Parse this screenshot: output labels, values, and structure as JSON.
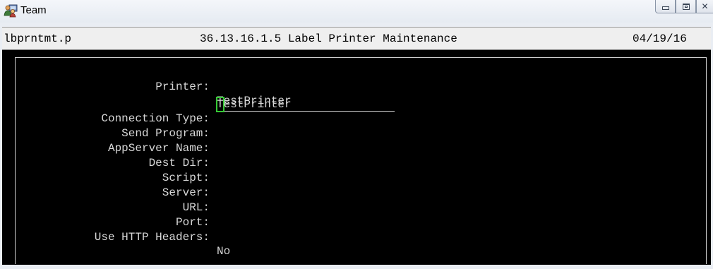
{
  "window": {
    "title": "Team",
    "icon": "team-app-icon",
    "controls": [
      "minimize-icon",
      "maximize-icon",
      "close-icon"
    ]
  },
  "header": {
    "program": "lbprntmt.p",
    "menu_title": "36.13.16.1.5 Label Printer Maintenance",
    "date": "04/19/16"
  },
  "form": {
    "printer": {
      "label": "Printer:",
      "value": "TestPrinter"
    },
    "connection_type": {
      "label": "Connection Type:",
      "value_cursor_char": "T",
      "value_rest": "estPrinter"
    },
    "send_program": {
      "label": "Send Program:",
      "value": ""
    },
    "appserver_name": {
      "label": "AppServer Name:",
      "value": ""
    },
    "dest_dir": {
      "label": "Dest Dir:",
      "value": ""
    },
    "script": {
      "label": "Script:",
      "value": ""
    },
    "server": {
      "label": "Server:",
      "value": ""
    },
    "url": {
      "label": "URL:",
      "value": ""
    },
    "port": {
      "label": "Port:",
      "value": ""
    },
    "use_http_headers": {
      "label": "Use HTTP Headers:",
      "value": "No"
    }
  },
  "colors": {
    "terminal_bg": "#000000",
    "terminal_fg": "#d8d8d8",
    "cursor": "#35c935",
    "header_bg": "#efefef"
  }
}
